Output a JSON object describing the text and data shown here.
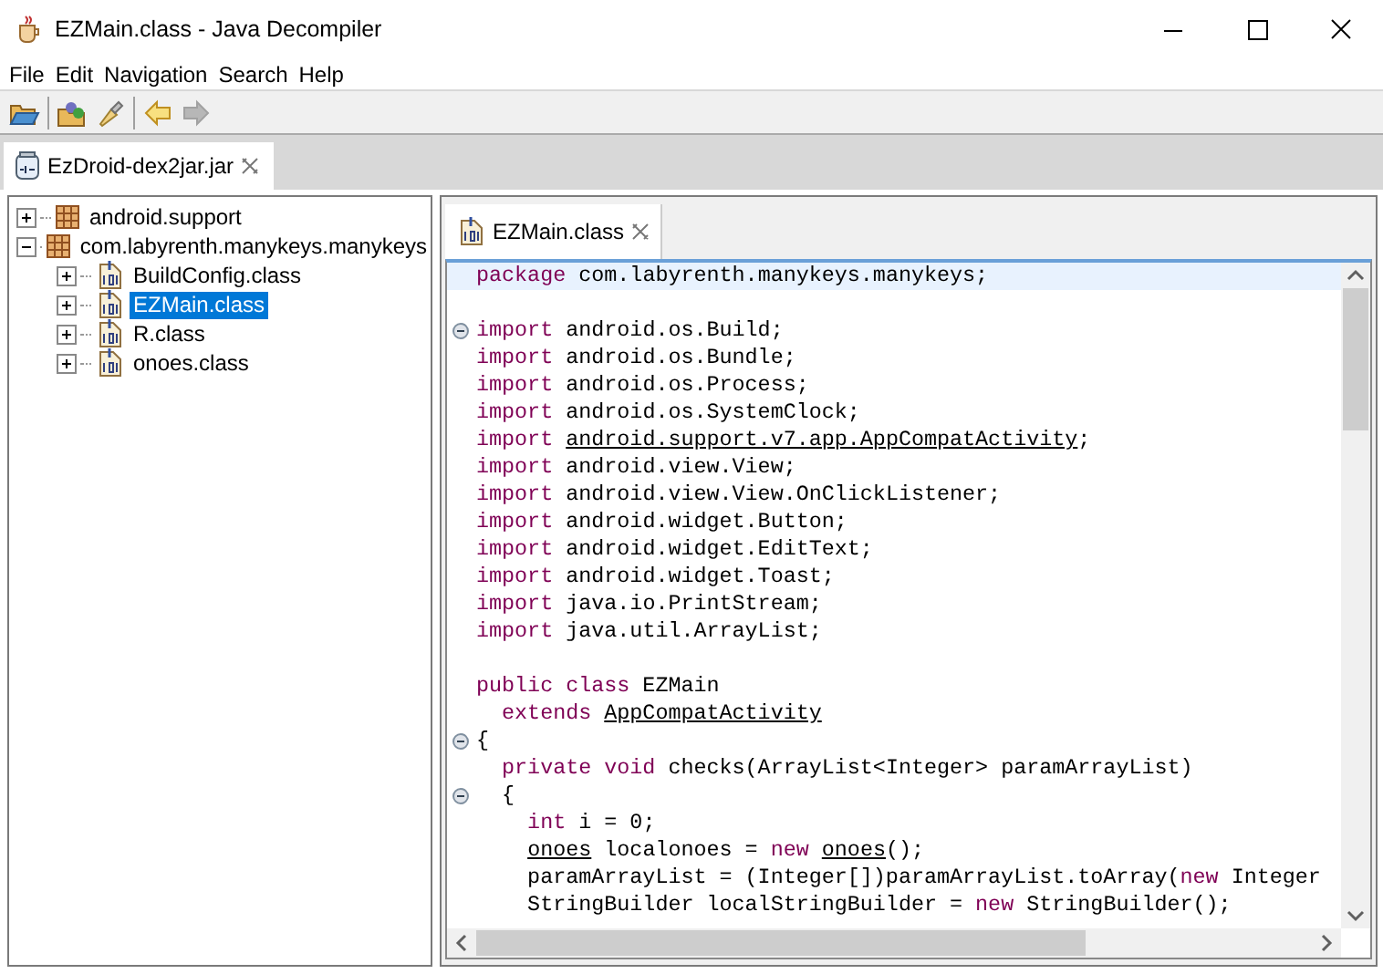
{
  "window": {
    "title": "EZMain.class - Java Decompiler"
  },
  "menu": [
    "File",
    "Edit",
    "Navigation",
    "Search",
    "Help"
  ],
  "toolbar": [
    {
      "kind": "open",
      "disabled": false
    },
    {
      "kind": "sep"
    },
    {
      "kind": "open-type",
      "disabled": false
    },
    {
      "kind": "search",
      "disabled": false
    },
    {
      "kind": "sep"
    },
    {
      "kind": "back",
      "disabled": false
    },
    {
      "kind": "forward",
      "disabled": true
    }
  ],
  "file_tabs": [
    {
      "label": "EzDroid-dex2jar.jar",
      "selected": true
    }
  ],
  "tree": [
    {
      "label": "android.support",
      "kind": "package",
      "expanded": false,
      "selected": false
    },
    {
      "label": "com.labyrenth.manykeys.manykeys",
      "kind": "package",
      "expanded": true,
      "selected": false,
      "children": [
        {
          "label": "BuildConfig.class",
          "kind": "class",
          "expanded": false,
          "selected": false
        },
        {
          "label": "EZMain.class",
          "kind": "class",
          "expanded": false,
          "selected": true
        },
        {
          "label": "R.class",
          "kind": "class",
          "expanded": false,
          "selected": false
        },
        {
          "label": "onoes.class",
          "kind": "class",
          "expanded": false,
          "selected": false
        }
      ]
    }
  ],
  "editor_tabs": [
    {
      "label": "EZMain.class",
      "selected": true
    }
  ],
  "code": [
    {
      "highlighted": true,
      "fold": false,
      "segments": [
        {
          "kind": "kw",
          "text": "package"
        },
        {
          "kind": "text",
          "text": " com.labyrenth.manykeys.manykeys;"
        }
      ]
    },
    {
      "highlighted": false,
      "fold": false
    },
    {
      "highlighted": false,
      "fold": true,
      "segments": [
        {
          "kind": "kw",
          "text": "import"
        },
        {
          "kind": "text",
          "text": " android.os.Build;"
        }
      ]
    },
    {
      "highlighted": false,
      "fold": false,
      "segments": [
        {
          "kind": "kw",
          "text": "import"
        },
        {
          "kind": "text",
          "text": " android.os.Bundle;"
        }
      ]
    },
    {
      "highlighted": false,
      "fold": false,
      "segments": [
        {
          "kind": "kw",
          "text": "import"
        },
        {
          "kind": "text",
          "text": " android.os.Process;"
        }
      ]
    },
    {
      "highlighted": false,
      "fold": false,
      "segments": [
        {
          "kind": "kw",
          "text": "import"
        },
        {
          "kind": "text",
          "text": " android.os.SystemClock;"
        }
      ]
    },
    {
      "highlighted": false,
      "fold": false,
      "segments": [
        {
          "kind": "kw",
          "text": "import"
        },
        {
          "kind": "ref",
          "text": " android.support.v7.app.AppCompatActivity"
        },
        {
          "kind": "text",
          "text": ";"
        }
      ]
    },
    {
      "highlighted": false,
      "fold": false,
      "segments": [
        {
          "kind": "kw",
          "text": "import"
        },
        {
          "kind": "text",
          "text": " android.view.View;"
        }
      ]
    },
    {
      "highlighted": false,
      "fold": false,
      "segments": [
        {
          "kind": "kw",
          "text": "import"
        },
        {
          "kind": "text",
          "text": " android.view.View.OnClickListener;"
        }
      ]
    },
    {
      "highlighted": false,
      "fold": false,
      "segments": [
        {
          "kind": "kw",
          "text": "import"
        },
        {
          "kind": "text",
          "text": " android.widget.Button;"
        }
      ]
    },
    {
      "highlighted": false,
      "fold": false,
      "segments": [
        {
          "kind": "kw",
          "text": "import"
        },
        {
          "kind": "text",
          "text": " android.widget.EditText;"
        }
      ]
    },
    {
      "highlighted": false,
      "fold": false,
      "segments": [
        {
          "kind": "kw",
          "text": "import"
        },
        {
          "kind": "text",
          "text": " android.widget.Toast;"
        }
      ]
    },
    {
      "highlighted": false,
      "fold": false,
      "segments": [
        {
          "kind": "kw",
          "text": "import"
        },
        {
          "kind": "text",
          "text": " java.io.PrintStream;"
        }
      ]
    },
    {
      "highlighted": false,
      "fold": false,
      "segments": [
        {
          "kind": "kw",
          "text": "import"
        },
        {
          "kind": "text",
          "text": " java.util.ArrayList;"
        }
      ]
    },
    {
      "highlighted": false,
      "fold": false
    },
    {
      "highlighted": false,
      "fold": false,
      "segments": [
        {
          "kind": "kw",
          "text": "public class"
        },
        {
          "kind": "text",
          "text": " EZMain"
        }
      ]
    },
    {
      "highlighted": false,
      "fold": false,
      "segments": [
        {
          "kind": "kw",
          "text": "  extends"
        },
        {
          "kind": "ref",
          "text": " AppCompatActivity"
        }
      ]
    },
    {
      "highlighted": false,
      "fold": true,
      "segments": [
        {
          "kind": "text",
          "text": "{"
        }
      ]
    },
    {
      "highlighted": false,
      "fold": false,
      "segments": [
        {
          "kind": "kw",
          "text": "  private void"
        },
        {
          "kind": "text",
          "text": " checks(ArrayList<Integer> paramArrayList)"
        }
      ]
    },
    {
      "highlighted": false,
      "fold": true,
      "segments": [
        {
          "kind": "text",
          "text": "  {"
        }
      ]
    },
    {
      "highlighted": false,
      "fold": false,
      "segments": [
        {
          "kind": "kw",
          "text": "    int"
        },
        {
          "kind": "text",
          "text": " i = 0;"
        }
      ]
    },
    {
      "highlighted": false,
      "fold": false,
      "segments": [
        {
          "kind": "ref",
          "text": "    onoes"
        },
        {
          "kind": "text",
          "text": " localonoes = "
        },
        {
          "kind": "kw",
          "text": "new"
        },
        {
          "kind": "ref",
          "text": " onoes"
        },
        {
          "kind": "text",
          "text": "();"
        }
      ]
    },
    {
      "highlighted": false,
      "fold": false,
      "segments": [
        {
          "kind": "text",
          "text": "    paramArrayList = (Integer[])paramArrayList.toArray("
        },
        {
          "kind": "kw",
          "text": "new"
        },
        {
          "kind": "text",
          "text": " Integer"
        }
      ]
    },
    {
      "highlighted": false,
      "fold": false,
      "segments": [
        {
          "kind": "text",
          "text": "    StringBuilder localStringBuilder = "
        },
        {
          "kind": "kw",
          "text": "new"
        },
        {
          "kind": "text",
          "text": " StringBuilder();"
        }
      ]
    }
  ]
}
